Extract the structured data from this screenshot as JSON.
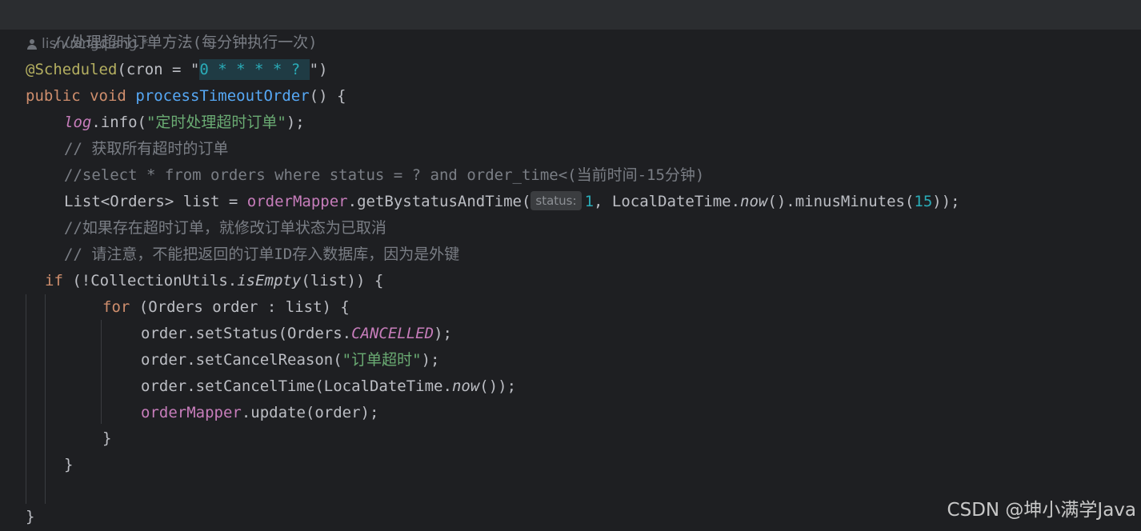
{
  "editor": {
    "header_comment": "//处理超时订单方法(每分钟执行一次)",
    "author": "lishuangqiang *",
    "annotation": "@Scheduled",
    "cron_open": "(cron = \"",
    "cron_value": "0 * * * * ? ",
    "cron_close": "\")",
    "kw_public": "public",
    "kw_void": "void",
    "method_name": "processTimeoutOrder",
    "method_sig_tail": "() {",
    "log_obj": "log",
    "log_call": ".info(",
    "log_msg": "\"定时处理超时订单\"",
    "log_tail": ");",
    "comment_fetch": "// 获取所有超时的订单",
    "comment_sql": "//select * from orders where status = ? and order_time<(当前时间-15分钟)",
    "list_decl": "List<Orders> list = ",
    "mapper": "orderMapper",
    "get_call": ".getBystatusAndTime(",
    "hint_status": "status:",
    "status_val": "1",
    "ldt_part": ", LocalDateTime.",
    "now": "now",
    "minus_part": "().minusMinutes(",
    "minutes_val": "15",
    "list_tail": "));",
    "comment_update": "//如果存在超时订单，就修改订单状态为已取消",
    "comment_note": "// 请注意，不能把返回的订单ID存入数据库，因为是外键",
    "kw_if": "if",
    "if_mid": " (!CollectionUtils.",
    "is_empty": "isEmpty",
    "if_tail": "(list)) {",
    "kw_for": "for",
    "for_tail": " (Orders order : list) {",
    "set_status": "order.setStatus(Orders.",
    "cancelled": "CANCELLED",
    "close_stmt": ");",
    "set_reason": "order.setCancelReason(",
    "reason_str": "\"订单超时\"",
    "set_time": "order.setCancelTime(LocalDateTime.",
    "now2": "now",
    "set_time_tail": "());",
    "update_call": ".update(order);",
    "brace_for": "}",
    "brace_if": "}",
    "brace_method": "}"
  },
  "watermark": "CSDN @坤小满学Java",
  "colors": {
    "background": "#1e1f22",
    "keyword": "#cf8e6d",
    "annotation": "#b3ae60",
    "function": "#56a8f5",
    "string": "#6aab73",
    "comment": "#7a7e85",
    "number": "#2aacb8",
    "field": "#c77dbb"
  }
}
